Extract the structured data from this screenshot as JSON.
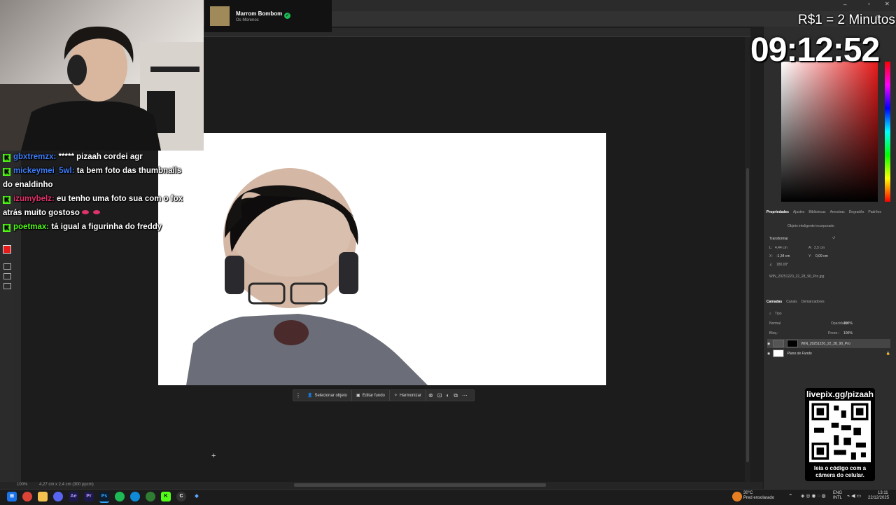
{
  "chat": {
    "messages": [
      {
        "user": "gbxtremzx:",
        "user_color": "#3f7cf5",
        "text": "***** pizaah cordei agr"
      },
      {
        "user": "mickeymei_5wl:",
        "user_color": "#3f7cf5",
        "text": "ta bem foto das thumbnails",
        "continuation": "do enaldinho"
      },
      {
        "user": "izumybelz:",
        "user_color": "#e0336b",
        "text": "eu tenho uma foto sua com o fox",
        "continuation": "atrás muito gostoso"
      },
      {
        "user": "poetmax:",
        "user_color": "#53fc18",
        "text": "tá igual a figurinha do freddy"
      }
    ]
  },
  "spotify": {
    "song_title": "Marrom Bombom",
    "artist": "Os Morenos"
  },
  "overlay": {
    "rate_text": "R$1 = 2 Minutos",
    "timer": "09:12:52",
    "qr_url": "livepix.gg/pizaah",
    "qr_caption_line1": "leia o código com a",
    "qr_caption_line2": "câmera do celular."
  },
  "context_bar": {
    "select_object": "Selecionar objeto",
    "edit_background": "Editar fundo",
    "harmonize": "Harmonizar"
  },
  "properties_panel": {
    "tabs": [
      "Propriedades",
      "Ajustes",
      "Bibliotecas",
      "Amostras",
      "Degradês",
      "Padrões"
    ],
    "object_type": "Objeto inteligente incorporado",
    "section_transform": "Transformar",
    "width_label": "L:",
    "width_value": "4,44 cm",
    "height_label": "A:",
    "height_value": "2,5 cm",
    "x_label": "X:",
    "x_value": "-1,34 cm",
    "y_label": "Y:",
    "y_value": "0,09 cm",
    "angle_value": "180,00°",
    "file_name": "WIN_20251220_22_28_90_Pro.jpg"
  },
  "layers_panel": {
    "tabs": [
      "Camadas",
      "Canais",
      "Demarcadores"
    ],
    "filter_kind": "Tipo",
    "blend_mode": "Normal",
    "opacity_label": "Opacidade:",
    "opacity_value": "100%",
    "lock_label": "Bloq.:",
    "fill_label": "Preen.:",
    "fill_value": "100%",
    "layers": [
      {
        "name": "WIN_20251220_22_28_90_Pro"
      },
      {
        "name": "Plano de Fundo"
      }
    ]
  },
  "statusbar": {
    "zoom": "100%",
    "doc_info": "4,27 cm x 2,4 cm (300 ppcm)"
  },
  "tray": {
    "weather_temp": "30°C",
    "weather_desc": "Pred ensolarado",
    "lang_line1": "ENG",
    "lang_line2": "INTL",
    "time": "13:11",
    "date": "22/12/2025"
  },
  "colors": {
    "kick_green": "#53fc18",
    "spotify_green": "#1db954",
    "foreground_swatch": "#e81b1b"
  }
}
